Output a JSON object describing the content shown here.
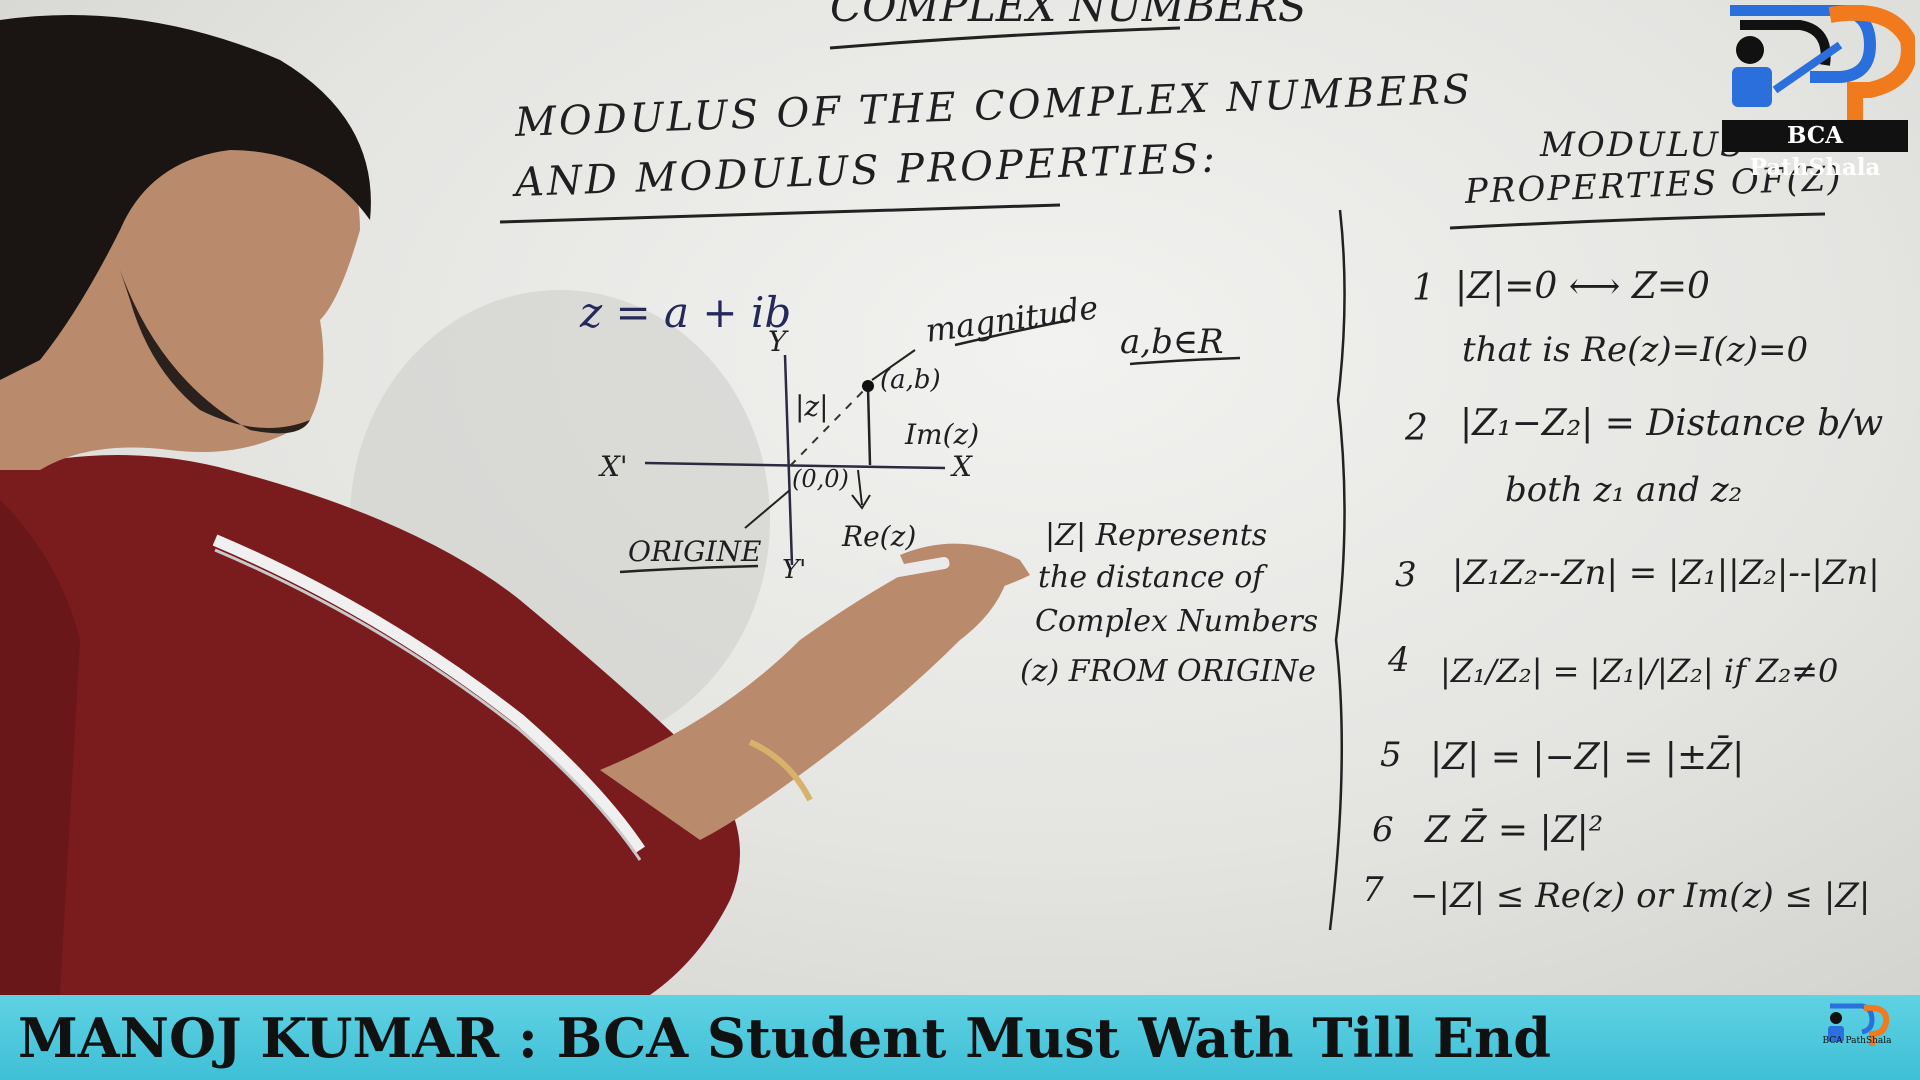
{
  "board": {
    "top_title": "COMPLEX NUMBERS",
    "heading_line1": "MODULUS OF THE COMPLEX NUMBERS",
    "heading_line2": "AND MODULUS PROPERTIES:",
    "equation": "z = a + ib",
    "set_note": "a,b∈R",
    "diagram": {
      "y_label": "Y",
      "y_neg_label": "Y'",
      "x_label": "X",
      "x_neg_label": "X'",
      "point_label": "(a,b)",
      "origin_label": "(0,0)",
      "magnitude_label": "magnitude",
      "modulus_label": "|z|",
      "im_label": "Im(z)",
      "re_label": "Re(z)",
      "origine_label": "ORIGINE"
    },
    "explanation": [
      "|Z| Represents",
      "the distance of",
      "Complex Numbers",
      "(z) FROM ORIGINe"
    ],
    "properties_heading_line1": "MODULUS",
    "properties_heading_line2": "PROPERTIES OF(Z)",
    "properties": [
      {
        "num": "1",
        "text": "|Z|=0  ⟷  Z=0"
      },
      {
        "num": "",
        "text": "that is Re(z)=I(z)=0"
      },
      {
        "num": "2",
        "text": "|Z₁−Z₂| = Distance b/w"
      },
      {
        "num": "",
        "text": "both z₁ and z₂"
      },
      {
        "num": "3",
        "text": "|Z₁Z₂--Zn| = |Z₁||Z₂|--|Zn|"
      },
      {
        "num": "4",
        "text": "|Z₁/Z₂| = |Z₁|/|Z₂|  if Z₂≠0"
      },
      {
        "num": "5",
        "text": "|Z| = |−Z| = |±Z̄|"
      },
      {
        "num": "6",
        "text": "Z Z̄ = |Z|²"
      },
      {
        "num": "7",
        "text": "−|Z| ≤ Re(z) or Im(z) ≤ |Z|"
      }
    ]
  },
  "logo": {
    "brand": "BCA PathShala",
    "colors": {
      "orange": "#f07a1c",
      "blue": "#2a6fdc",
      "dark": "#111111"
    }
  },
  "banner": {
    "text": "MANOJ KUMAR : BCA Student Must Wath Till End",
    "small_logo_text": "BCA PathShala",
    "color": "#4cc8dc"
  },
  "presenter": {
    "shirt_color": "#7a1b1d",
    "stripe_color": "#f0f0f0",
    "skin_color": "#b98a6c",
    "hair_color": "#1a1412"
  }
}
